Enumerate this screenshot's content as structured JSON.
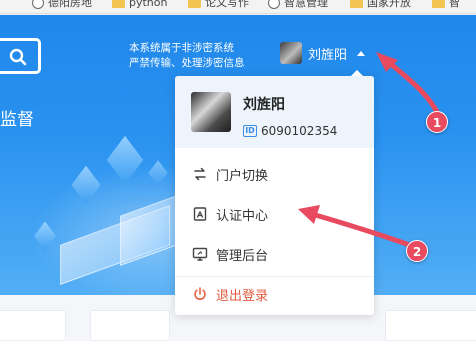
{
  "bookmarks": [
    {
      "icon": "globe-icon",
      "label": "德阳房地"
    },
    {
      "icon": "folder-icon",
      "label": "python"
    },
    {
      "icon": "folder-icon",
      "label": "论文写作"
    },
    {
      "icon": "globe-icon",
      "label": "智慧管理"
    },
    {
      "icon": "folder-icon",
      "label": "国家开放"
    },
    {
      "icon": "folder-icon",
      "label": "智"
    }
  ],
  "header": {
    "side_title": "监督",
    "notice_line1": "本系统属于非涉密系统",
    "notice_line2": "严禁传输、处理涉密信息",
    "username": "刘旌阳"
  },
  "dropdown": {
    "name": "刘旌阳",
    "id_badge": "ID",
    "user_id": "6090102354",
    "items": [
      {
        "label": "门户切换",
        "icon": "switch-icon"
      },
      {
        "label": "认证中心",
        "icon": "certificate-icon"
      },
      {
        "label": "管理后台",
        "icon": "monitor-icon"
      },
      {
        "label": "退出登录",
        "icon": "power-icon"
      }
    ]
  },
  "annotations": [
    {
      "label": "1"
    },
    {
      "label": "2"
    }
  ],
  "colors": {
    "header_blue": "#1f87ea",
    "logout_red": "#e35a3f",
    "annotation_red": "#e84a5f"
  }
}
